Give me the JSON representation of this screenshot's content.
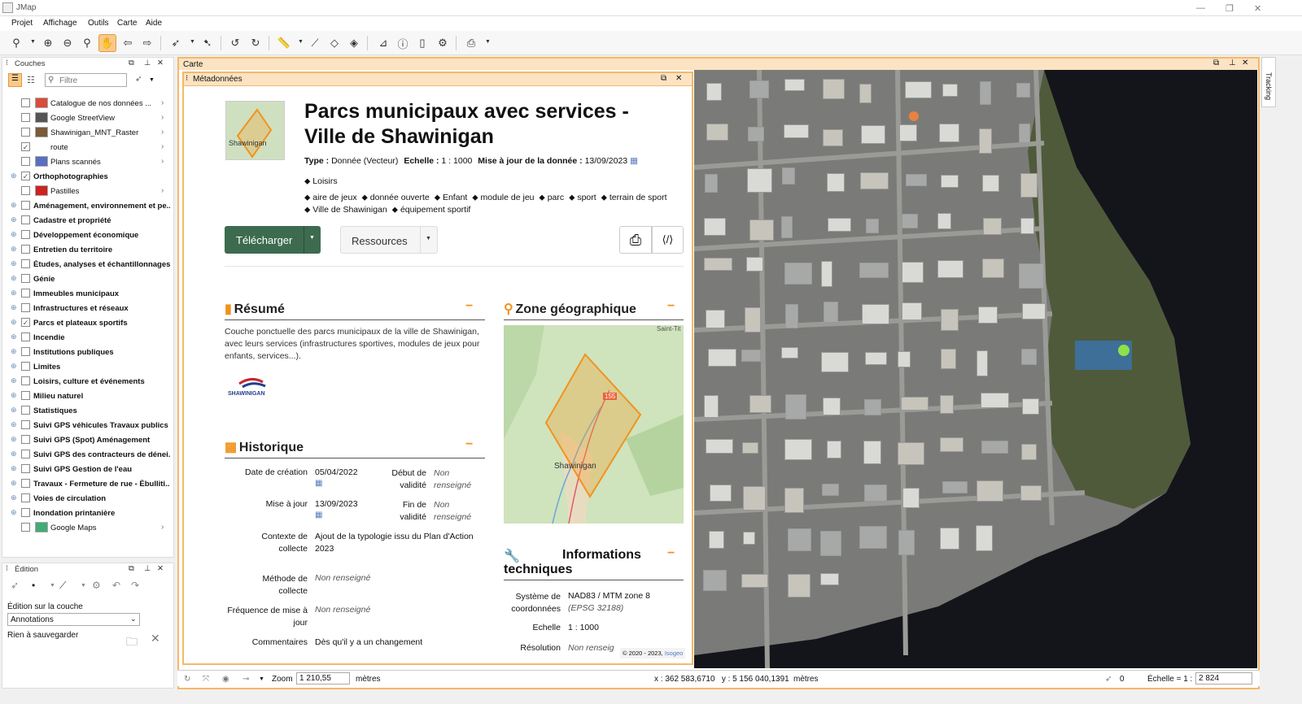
{
  "app": {
    "title": "JMap"
  },
  "menu": [
    "Projet",
    "Affichage",
    "Outils",
    "Carte",
    "Aide"
  ],
  "layers_panel": {
    "title": "Couches",
    "filter_placeholder": "Filtre",
    "items": [
      {
        "label": "Catalogue de nos données ...",
        "type": "layer",
        "checked": false,
        "arrow": true
      },
      {
        "label": "Google StreetView",
        "type": "layer",
        "checked": false,
        "arrow": true
      },
      {
        "label": "Shawinigan_MNT_Raster",
        "type": "layer",
        "checked": false,
        "arrow": true
      },
      {
        "label": "route",
        "type": "layer",
        "checked": true,
        "arrow": true
      },
      {
        "label": "Plans scannés",
        "type": "layer",
        "checked": false,
        "arrow": true
      },
      {
        "label": "Orthophotographies",
        "type": "group",
        "checked": true,
        "arrow": false
      },
      {
        "label": "Pastilles",
        "type": "layer",
        "checked": false,
        "arrow": true
      },
      {
        "label": "Aménagement, environnement et pe...",
        "type": "group",
        "checked": false
      },
      {
        "label": "Cadastre et propriété",
        "type": "group",
        "checked": false
      },
      {
        "label": "Développement économique",
        "type": "group",
        "checked": false
      },
      {
        "label": "Entretien du territoire",
        "type": "group",
        "checked": false
      },
      {
        "label": "Études, analyses et échantillonnages",
        "type": "group",
        "checked": false
      },
      {
        "label": "Génie",
        "type": "group",
        "checked": false
      },
      {
        "label": "Immeubles municipaux",
        "type": "group",
        "checked": false
      },
      {
        "label": "Infrastructures et réseaux",
        "type": "group",
        "checked": false
      },
      {
        "label": "Parcs et plateaux sportifs",
        "type": "group",
        "checked": true
      },
      {
        "label": "Incendie",
        "type": "group",
        "checked": false
      },
      {
        "label": "Institutions publiques",
        "type": "group",
        "checked": false
      },
      {
        "label": "Limites",
        "type": "group",
        "checked": false
      },
      {
        "label": "Loisirs, culture et événements",
        "type": "group",
        "checked": false
      },
      {
        "label": "Milieu naturel",
        "type": "group",
        "checked": false
      },
      {
        "label": "Statistiques",
        "type": "group",
        "checked": false
      },
      {
        "label": "Suivi GPS véhicules Travaux publics",
        "type": "group",
        "checked": false
      },
      {
        "label": "Suivi GPS (Spot) Aménagement",
        "type": "group",
        "checked": false
      },
      {
        "label": "Suivi GPS des contracteurs de dénei...",
        "type": "group",
        "checked": false
      },
      {
        "label": "Suivi GPS Gestion de l'eau",
        "type": "group",
        "checked": false
      },
      {
        "label": "Travaux - Fermeture de rue - Ébulliti...",
        "type": "group",
        "checked": false
      },
      {
        "label": "Voies de circulation",
        "type": "group",
        "checked": false
      },
      {
        "label": "Inondation printanière",
        "type": "group",
        "checked": false
      },
      {
        "label": "Google Maps",
        "type": "layer",
        "checked": false,
        "arrow": true
      }
    ]
  },
  "edition_panel": {
    "title": "Édition",
    "layer_label": "Édition sur la couche",
    "layer_value": "Annotations",
    "status": "Rien à sauvegarder"
  },
  "map_panel": {
    "title": "Carte",
    "tracking": "Tracking"
  },
  "metadata": {
    "panel_title": "Métadonnées",
    "thumb_label": "Shawinigan",
    "title": "Parcs municipaux avec services - Ville de Shawinigan",
    "type_label": "Type :",
    "type_value": "Donnée (Vecteur)",
    "scale_label": "Echelle :",
    "scale_value": "1 : 1000",
    "update_label": "Mise à jour de la donnée :",
    "update_value": "13/09/2023",
    "category": "Loisirs",
    "keywords": [
      "aire de jeux",
      "donnée ouverte",
      "Enfant",
      "module de jeu",
      "parc",
      "sport",
      "terrain de sport",
      "Ville de Shawinigan",
      "équipement sportif"
    ],
    "download_label": "Télécharger",
    "resources_label": "Ressources",
    "summary": {
      "title": "Résumé",
      "text": "Couche ponctuelle des parcs municipaux de la ville de Shawinigan, avec leurs services (infrastructures sportives, modules de jeux pour enfants, services...).",
      "logo_text": "SHAWINIGAN"
    },
    "history": {
      "title": "Historique",
      "creation_label": "Date de création",
      "creation_value": "05/04/2022",
      "validity_start_label": "Début de validité",
      "validity_start_value": "Non renseigné",
      "update_label": "Mise à jour",
      "update_value": "13/09/2023",
      "validity_end_label": "Fin de validité",
      "validity_end_value": "Non renseigné",
      "context_label": "Contexte de collecte",
      "context_value": "Ajout de la typologie issu du Plan d'Action 2023",
      "method_label": "Méthode de collecte",
      "method_value": "Non renseigné",
      "frequency_label": "Fréquence de mise à jour",
      "frequency_value": "Non renseigné",
      "comments_label": "Commentaires",
      "comments_value": "Dès qu'il y a un changement"
    },
    "geo": {
      "title": "Zone géographique",
      "map_label": "Shawinigan",
      "map_label_top": "Saint-Tit",
      "road_badge": "155"
    },
    "tech": {
      "title": "Informations techniques",
      "system_label": "Système de coordonnées",
      "system_value": "NAD83 / MTM zone 8",
      "system_epsg": "(EPSG 32188)",
      "scale_label": "Echelle",
      "scale_value": "1 : 1000",
      "resolution_label": "Résolution",
      "resolution_value": "Non renseig",
      "copyright": "© 2020 - 2023,",
      "copyright_brand": "Isogeo"
    }
  },
  "statusbar": {
    "zoom_label": "Zoom",
    "zoom_value": "1 210,55",
    "zoom_unit": "mètres",
    "coords": "x : 362 583,6710   y : 5 156 040,1391",
    "coords_unit": "mètres",
    "selection_count": "0",
    "scale_label": "Échelle = 1 :",
    "scale_value": "2 824"
  },
  "colors": {
    "accent": "#f0931d",
    "download_button": "#3d6b4f",
    "panel_border": "#f5b867"
  }
}
